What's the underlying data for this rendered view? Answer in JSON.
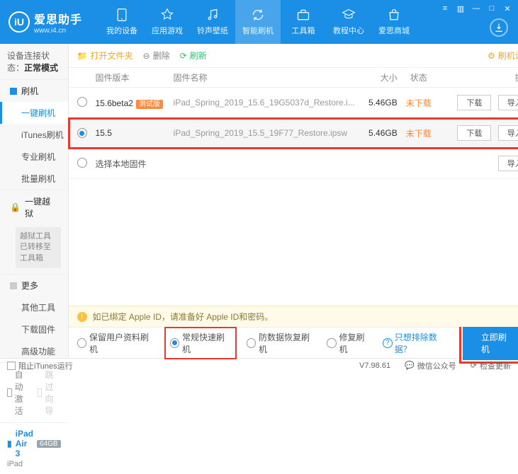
{
  "brand": {
    "name": "爱思助手",
    "url": "www.i4.cn",
    "badge": "iU"
  },
  "nav": {
    "items": [
      {
        "label": "我的设备"
      },
      {
        "label": "应用游戏"
      },
      {
        "label": "铃声壁纸"
      },
      {
        "label": "智能刷机"
      },
      {
        "label": "工具箱"
      },
      {
        "label": "教程中心"
      },
      {
        "label": "爱思商城"
      }
    ]
  },
  "sidebar": {
    "status_label": "设备连接状态：",
    "status_value": "正常模式",
    "flash": {
      "header": "刷机",
      "items": [
        "一键刷机",
        "iTunes刷机",
        "专业刷机",
        "批量刷机"
      ]
    },
    "jailbreak": {
      "header": "一键越狱",
      "note": "越狱工具已转移至\n工具箱"
    },
    "more": {
      "header": "更多",
      "items": [
        "其他工具",
        "下载固件",
        "高级功能"
      ]
    },
    "auto_activate": "自动激活",
    "skip_guide": "跳过向导",
    "device": {
      "name": "iPad Air 3",
      "storage": "64GB",
      "type": "iPad"
    }
  },
  "toolbar": {
    "open_folder": "打开文件夹",
    "delete": "删除",
    "refresh": "刷新",
    "settings": "刷机设置"
  },
  "table": {
    "headers": {
      "version": "固件版本",
      "name": "固件名称",
      "size": "大小",
      "status": "状态",
      "ops": "操作"
    },
    "rows": [
      {
        "version": "15.6beta2",
        "beta": "测试版",
        "filename": "iPad_Spring_2019_15.6_19G5037d_Restore.i...",
        "size": "5.46GB",
        "status": "未下载",
        "selected": false
      },
      {
        "version": "15.5",
        "filename": "iPad_Spring_2019_15.5_19F77_Restore.ipsw",
        "size": "5.46GB",
        "status": "未下载",
        "selected": true
      }
    ],
    "local_row": "选择本地固件",
    "btn_download": "下载",
    "btn_import": "导入"
  },
  "info_bar": "如已绑定 Apple ID，请准备好 Apple ID和密码。",
  "options": {
    "keep_data": "保留用户资料刷机",
    "normal": "常规快速刷机",
    "anti_recovery": "防数据恢复刷机",
    "repair": "修复刷机",
    "exclude": "只想排除数据？",
    "flash_now": "立即刷机"
  },
  "footer": {
    "block_itunes": "阻止iTunes运行",
    "version": "V7.98.61",
    "wechat": "微信公众号",
    "check_update": "检查更新"
  }
}
